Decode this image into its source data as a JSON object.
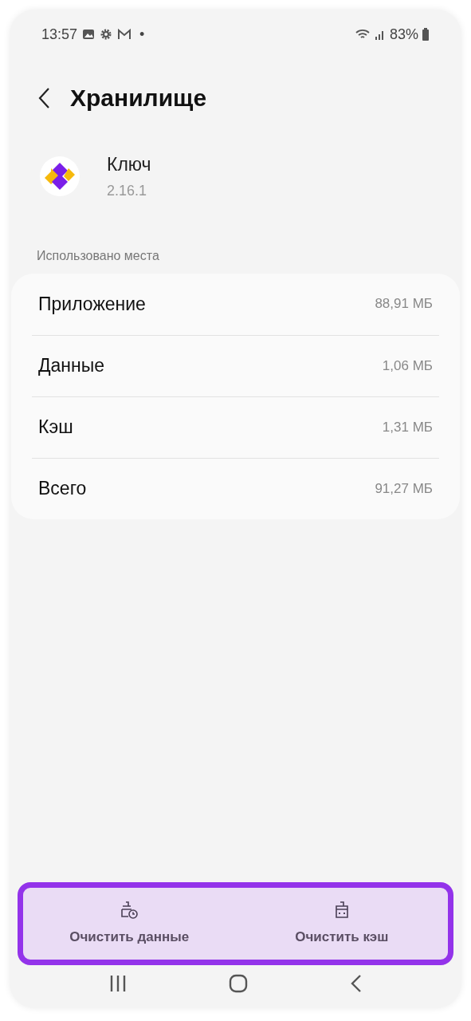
{
  "status_bar": {
    "time": "13:57",
    "dot": "•",
    "battery": "83%"
  },
  "header": {
    "title": "Хранилище"
  },
  "app": {
    "name": "Ключ",
    "version": "2.16.1"
  },
  "section_label": "Использовано места",
  "rows": [
    {
      "label": "Приложение",
      "value": "88,91 МБ"
    },
    {
      "label": "Данные",
      "value": "1,06 МБ"
    },
    {
      "label": "Кэш",
      "value": "1,31 МБ"
    },
    {
      "label": "Всего",
      "value": "91,27 МБ"
    }
  ],
  "actions": [
    {
      "kind": "data",
      "label": "Очистить данные"
    },
    {
      "kind": "cache",
      "label": "Очистить кэш"
    }
  ]
}
